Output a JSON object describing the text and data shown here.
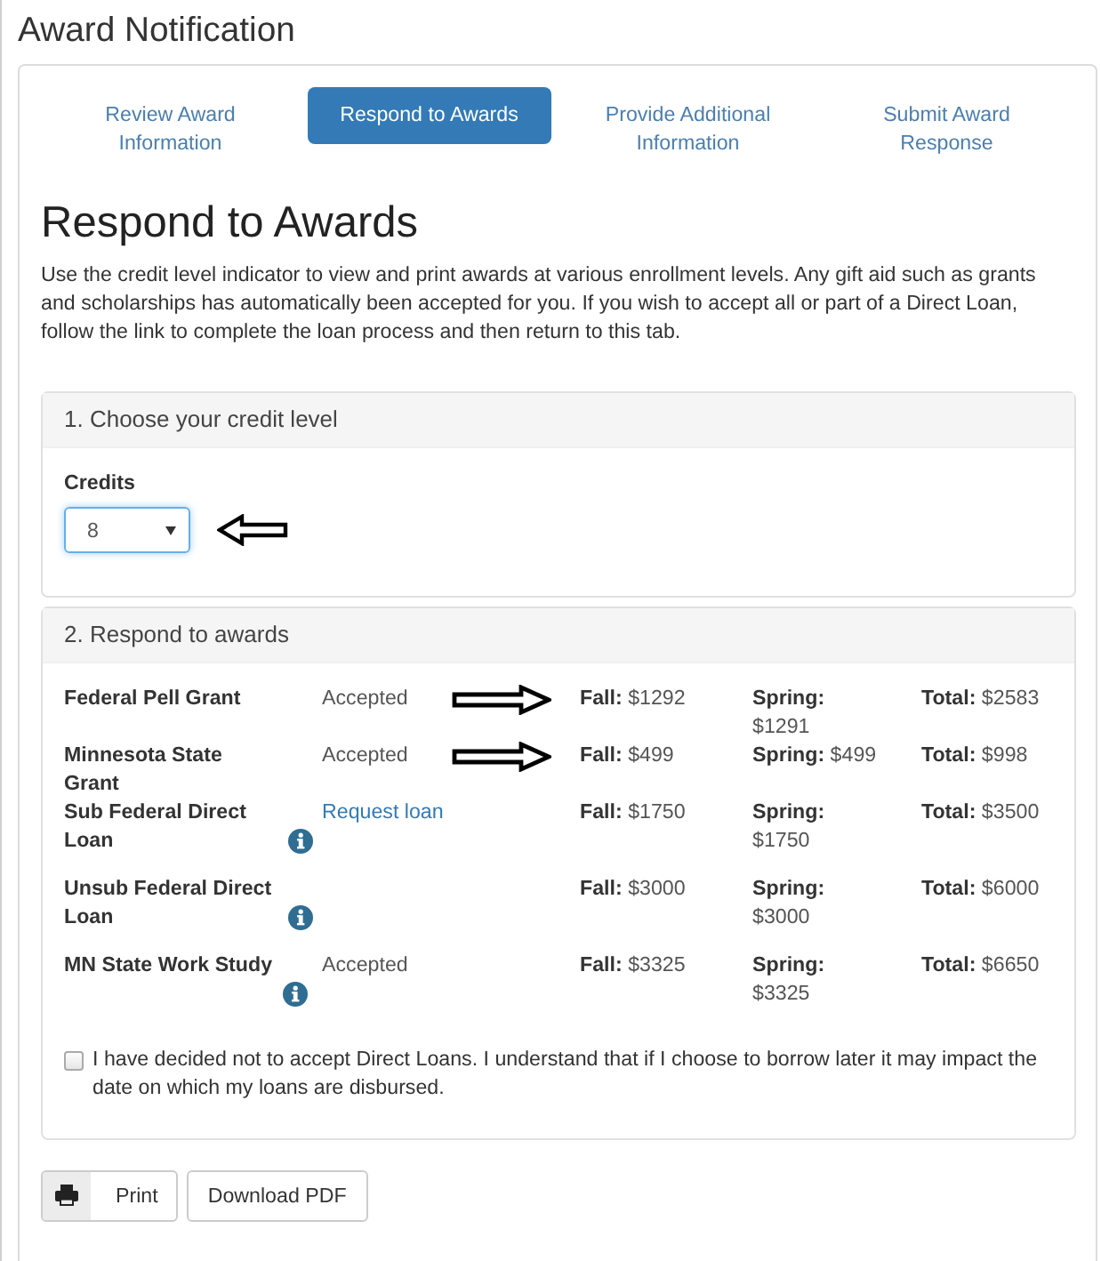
{
  "page_title": "Award Notification",
  "tabs": [
    {
      "label": "Review Award Information",
      "selected": false
    },
    {
      "label": "Respond to Awards",
      "selected": true
    },
    {
      "label": "Provide Additional Information",
      "selected": false
    },
    {
      "label": "Submit Award Response",
      "selected": false
    }
  ],
  "heading": "Respond to Awards",
  "intro": "Use the credit level indicator to view and print awards at various enrollment levels. Any gift aid such as grants and scholarships has automatically been accepted for you. If you wish to accept all or part of a Direct Loan, follow the link to complete the loan process and then return to this tab.",
  "credit_panel": {
    "title": "1. Choose your credit level",
    "field_label": "Credits",
    "value": "8",
    "arrow": true
  },
  "awards_panel": {
    "title": "2. Respond to awards",
    "rows": [
      {
        "name": "Federal Pell Grant",
        "info": false,
        "status": {
          "kind": "text",
          "text": "Accepted"
        },
        "arrow": true,
        "fall": "**Fall:** $1292",
        "spring": "**Spring:** $1291",
        "total": "**Total:** $2583"
      },
      {
        "name": "Minnesota State Grant",
        "info": false,
        "status": {
          "kind": "text",
          "text": "Accepted"
        },
        "arrow": true,
        "fall": "**Fall:** $499",
        "spring": "**Spring:** $499",
        "total": "**Total:** $998"
      },
      {
        "name": "Sub Federal Direct Loan",
        "info": true,
        "status": {
          "kind": "link",
          "text": "Request loan"
        },
        "arrow": false,
        "fall": "**Fall:** $1750",
        "spring": "**Spring:** $1750",
        "total": "**Total:** $3500"
      },
      {
        "name": "Unsub Federal Direct Loan",
        "info": true,
        "arrow": false,
        "fall": "**Fall:** $3000",
        "spring": "**Spring:** $3000",
        "total": "**Total:** $6000"
      },
      {
        "name": "MN State Work Study",
        "info": true,
        "status": {
          "kind": "text",
          "text": "Accepted"
        },
        "arrow": false,
        "fall": "**Fall:** $3325",
        "spring": "**Spring:** $3325",
        "total": "**Total:** $6650"
      }
    ],
    "decline": {
      "checked": false,
      "text": "I have decided not to accept Direct Loans. I understand that if I choose to borrow later it may impact the date on which my loans are disbursed."
    }
  },
  "buttons": [
    {
      "kind": "print",
      "label": "Print"
    },
    {
      "kind": "plain",
      "label": "Download PDF"
    }
  ]
}
